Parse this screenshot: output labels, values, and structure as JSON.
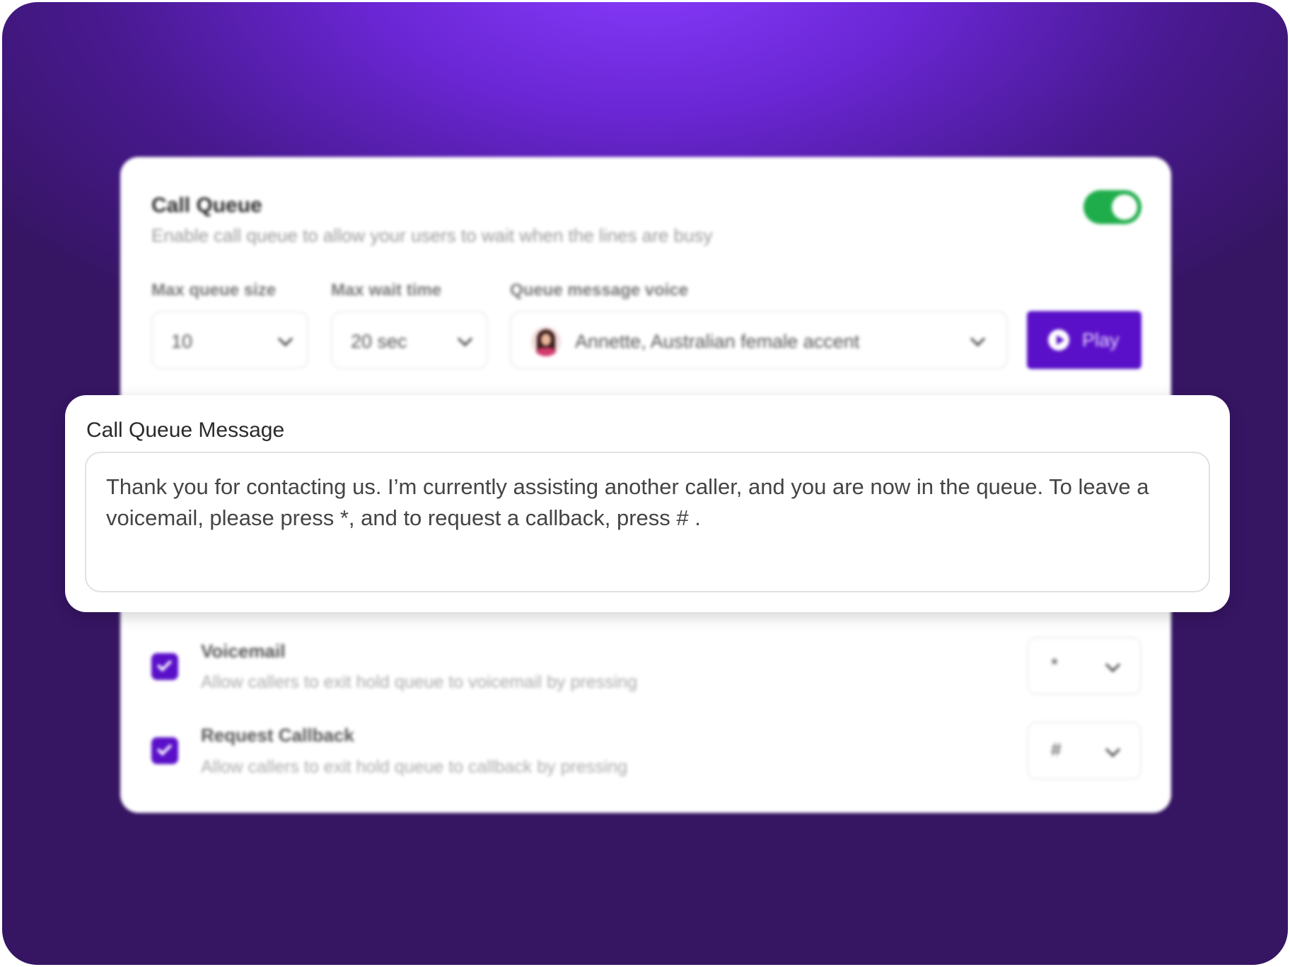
{
  "call_queue": {
    "title": "Call Queue",
    "subtitle": "Enable call queue to allow your users to wait when the lines are busy",
    "enabled": true,
    "max_queue_size": {
      "label": "Max queue size",
      "value": "10"
    },
    "max_wait_time": {
      "label": "Max wait time",
      "value": "20 sec"
    },
    "voice": {
      "label": "Queue message voice",
      "value": "Annette, Australian female accent"
    },
    "play_label": "Play",
    "options": [
      {
        "title": "Voicemail",
        "description": "Allow callers to exit hold queue to voicemail by pressing",
        "checked": true,
        "key": "*"
      },
      {
        "title": "Request Callback",
        "description": "Allow callers to exit hold queue to callback by pressing",
        "checked": true,
        "key": "#"
      }
    ]
  },
  "message_popup": {
    "label": "Call Queue Message",
    "text": "Thank you for contacting us. I’m currently assisting another caller, and you are now in the queue. To leave a voicemail, please press *, and to request a callback, press # ."
  },
  "colors": {
    "accent": "#5a10c9",
    "toggle_on": "#1fad4b",
    "background_dark": "#361563",
    "background_glow": "#8a3dff"
  }
}
